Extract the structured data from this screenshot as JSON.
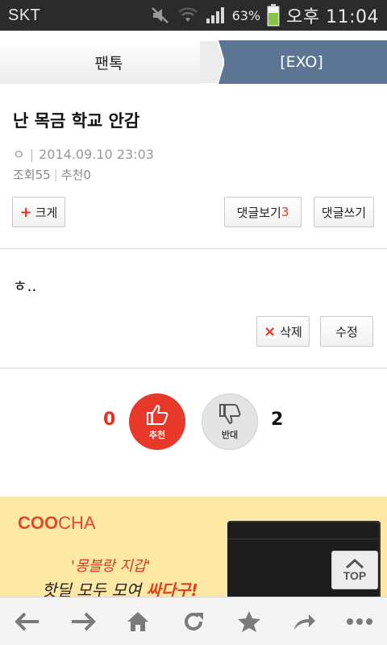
{
  "status_bar": {
    "carrier": "SKT",
    "battery_percent": "63%",
    "time": "오후 11:04",
    "icons": [
      "mute-icon",
      "wifi-icon",
      "signal-icon",
      "battery-icon"
    ]
  },
  "tabs": {
    "left_label": "팬톡",
    "right_label": "[EXO]"
  },
  "post": {
    "title": "난 목금 학교 안감",
    "author_mark": "ㅇ",
    "datetime": "2014.09.10 23:03",
    "views_label": "조회",
    "views": "55",
    "likes_label": "추천",
    "likes": "0",
    "body": "ㅎ..",
    "plus_symbol": "+",
    "enlarge_label": "크게",
    "view_comments_label": "댓글보기",
    "comment_count": "3",
    "write_comment_label": "댓글쓰기",
    "delete_symbol": "×",
    "delete_label": "삭제",
    "edit_label": "수정"
  },
  "votes": {
    "up_count": "0",
    "up_label": "추천",
    "down_count": "2",
    "down_label": "반대"
  },
  "ad": {
    "logo_coo": "COO",
    "logo_cha": "CHA",
    "line1": "'몽블랑 지갑'",
    "line2_prefix": "핫딜 모두 모여 ",
    "line2_highlight": "싸다구!"
  },
  "top_button": {
    "label": "TOP"
  },
  "bottom_bar": {
    "icons": [
      "back-icon",
      "forward-icon",
      "home-icon",
      "refresh-icon",
      "bookmark-icon",
      "share-icon",
      "more-icon"
    ]
  },
  "colors": {
    "accent_red": "#e53320",
    "tab_blue": "#5b7592",
    "ad_background": "#fde8a6"
  }
}
